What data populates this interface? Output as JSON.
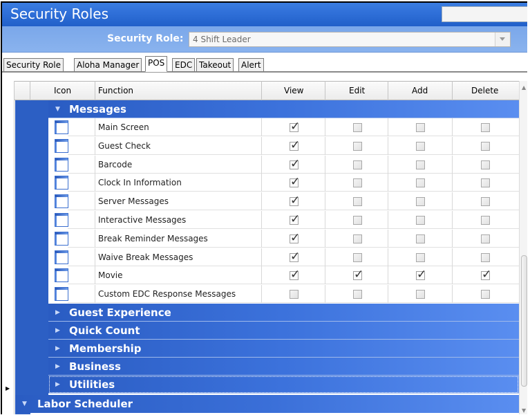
{
  "window": {
    "title": "Security Roles"
  },
  "role": {
    "label": "Security Role:",
    "value": "4 Shift Leader"
  },
  "tabs": [
    {
      "label": "Security Role",
      "active": false
    },
    {
      "label": "Aloha Manager",
      "active": false
    },
    {
      "label": "POS",
      "active": true
    },
    {
      "label": "EDC",
      "active": false
    },
    {
      "label": "Takeout",
      "active": false
    },
    {
      "label": "Alert",
      "active": false
    }
  ],
  "columns": {
    "icon": "Icon",
    "function": "Function",
    "view": "View",
    "edit": "Edit",
    "add": "Add",
    "delete": "Delete"
  },
  "groups": {
    "messages": "Messages",
    "guest_experience": "Guest Experience",
    "quick_count": "Quick Count",
    "membership": "Membership",
    "business": "Business",
    "utilities": "Utilities",
    "labor_scheduler": "Labor Scheduler"
  },
  "rows": [
    {
      "function": "Main Screen",
      "view": true,
      "edit": false,
      "add": false,
      "delete": false
    },
    {
      "function": "Guest Check",
      "view": true,
      "edit": false,
      "add": false,
      "delete": false
    },
    {
      "function": "Barcode",
      "view": true,
      "edit": false,
      "add": false,
      "delete": false
    },
    {
      "function": "Clock In Information",
      "view": true,
      "edit": false,
      "add": false,
      "delete": false
    },
    {
      "function": "Server Messages",
      "view": true,
      "edit": false,
      "add": false,
      "delete": false
    },
    {
      "function": "Interactive Messages",
      "view": true,
      "edit": false,
      "add": false,
      "delete": false
    },
    {
      "function": "Break Reminder Messages",
      "view": true,
      "edit": false,
      "add": false,
      "delete": false
    },
    {
      "function": "Waive Break Messages",
      "view": true,
      "edit": false,
      "add": false,
      "delete": false
    },
    {
      "function": "Movie",
      "view": true,
      "edit": true,
      "add": true,
      "delete": true
    },
    {
      "function": "Custom EDC Response Messages",
      "view": false,
      "edit": false,
      "add": false,
      "delete": false
    }
  ],
  "icons": {
    "row_icon": "window-icon",
    "collapse": "triangle-down-icon",
    "expand": "triangle-right-icon"
  }
}
